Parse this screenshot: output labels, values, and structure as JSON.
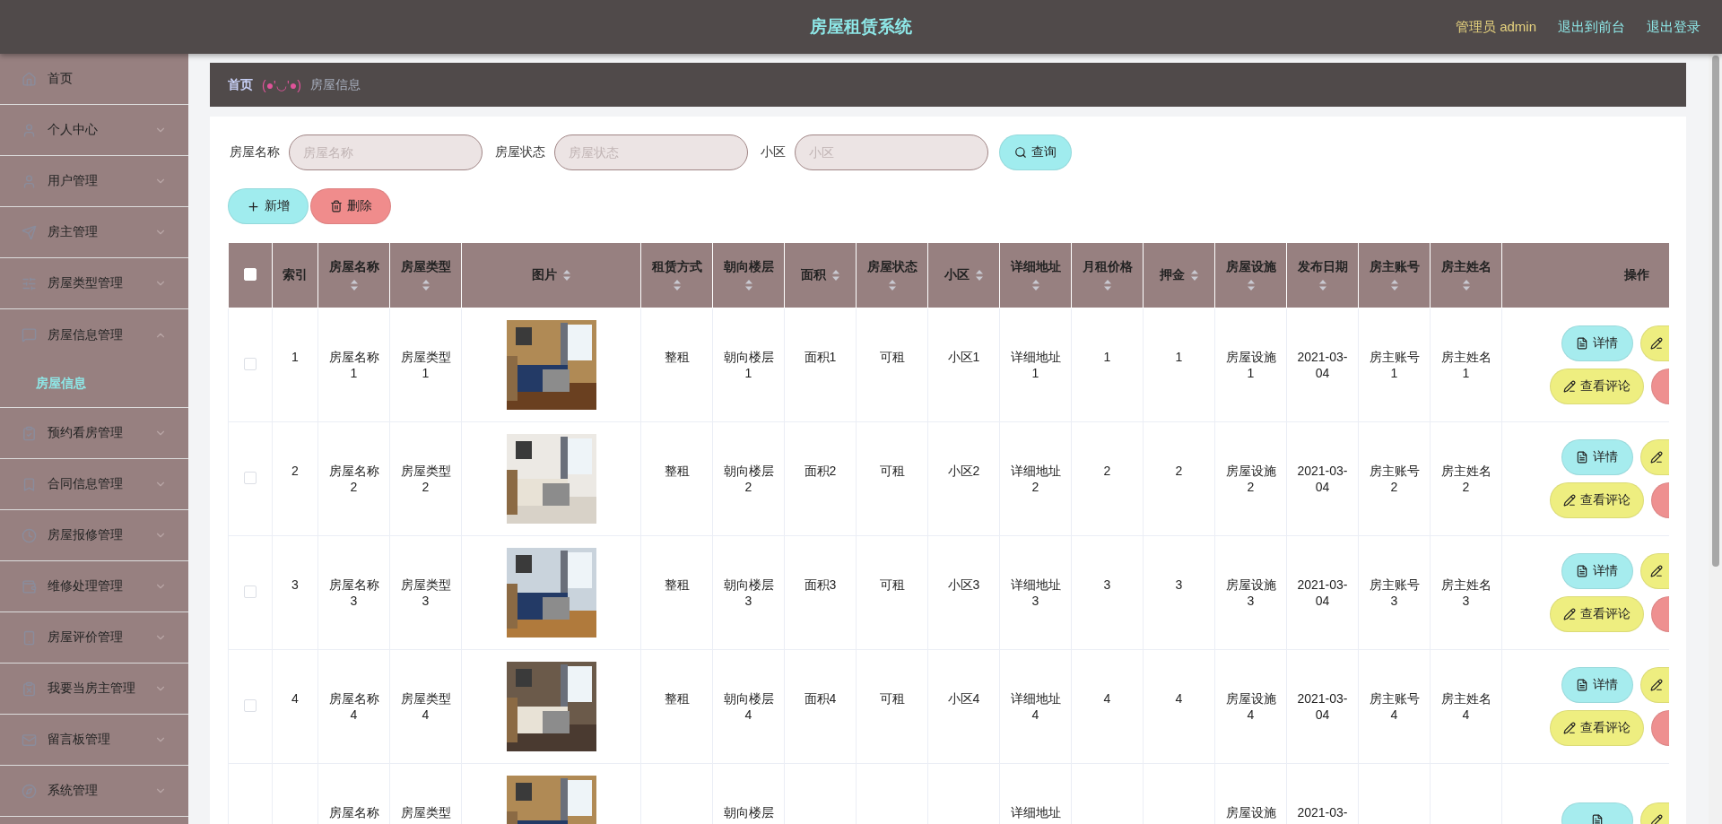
{
  "header": {
    "title": "房屋租赁系统",
    "user": "管理员 admin",
    "links": [
      "退出到前台",
      "退出登录"
    ]
  },
  "sidebar": {
    "items": [
      {
        "label": "首页",
        "kind": "link",
        "expanded": false
      },
      {
        "label": "个人中心",
        "kind": "menu",
        "expanded": false
      },
      {
        "label": "用户管理",
        "kind": "menu",
        "expanded": false
      },
      {
        "label": "房主管理",
        "kind": "menu",
        "expanded": false
      },
      {
        "label": "房屋类型管理",
        "kind": "menu",
        "expanded": false
      },
      {
        "label": "房屋信息管理",
        "kind": "menu",
        "expanded": true,
        "children": [
          {
            "label": "房屋信息",
            "selected": true
          }
        ]
      },
      {
        "label": "预约看房管理",
        "kind": "menu",
        "expanded": false
      },
      {
        "label": "合同信息管理",
        "kind": "menu",
        "expanded": false
      },
      {
        "label": "房屋报修管理",
        "kind": "menu",
        "expanded": false
      },
      {
        "label": "维修处理管理",
        "kind": "menu",
        "expanded": false
      },
      {
        "label": "房屋评价管理",
        "kind": "menu",
        "expanded": false
      },
      {
        "label": "我要当房主管理",
        "kind": "menu",
        "expanded": false
      },
      {
        "label": "留言板管理",
        "kind": "menu",
        "expanded": false
      },
      {
        "label": "系统管理",
        "kind": "menu",
        "expanded": false
      }
    ]
  },
  "breadcrumb": {
    "home": "首页",
    "separator": "(●'◡'●)",
    "current": "房屋信息"
  },
  "search": {
    "fields": [
      {
        "label": "房屋名称",
        "placeholder": "房屋名称"
      },
      {
        "label": "房屋状态",
        "placeholder": "房屋状态"
      },
      {
        "label": "小区",
        "placeholder": "小区"
      }
    ],
    "button": "查询"
  },
  "actions": [
    {
      "kind": "add",
      "label": "新增"
    },
    {
      "kind": "delete",
      "label": "删除"
    }
  ],
  "table": {
    "all_checked": false,
    "columns": [
      {
        "label": "索引",
        "sortable": false
      },
      {
        "label": "房屋名称",
        "sortable": true
      },
      {
        "label": "房屋类型",
        "sortable": true
      },
      {
        "label": "图片",
        "sortable": true
      },
      {
        "label": "租赁方式",
        "sortable": true
      },
      {
        "label": "朝向楼层",
        "sortable": true
      },
      {
        "label": "面积",
        "sortable": true
      },
      {
        "label": "房屋状态",
        "sortable": true
      },
      {
        "label": "小区",
        "sortable": true
      },
      {
        "label": "详细地址",
        "sortable": true
      },
      {
        "label": "月租价格",
        "sortable": true
      },
      {
        "label": "押金",
        "sortable": true
      },
      {
        "label": "房屋设施",
        "sortable": true
      },
      {
        "label": "发布日期",
        "sortable": true
      },
      {
        "label": "房主账号",
        "sortable": true
      },
      {
        "label": "房主姓名",
        "sortable": true
      },
      {
        "label": "操作",
        "sortable": false
      }
    ],
    "rows": [
      {
        "checked": false,
        "cells": [
          "1",
          "房屋名称 1",
          "房屋类型 1",
          {
            "kind": "picture"
          },
          "整租",
          "朝向楼层 1",
          "面积1",
          "可租",
          "小区1",
          "详细地址 1",
          "1",
          "1",
          "房屋设施 1",
          "2021-03-04",
          "房主账号 1",
          "房主姓名 1"
        ],
        "buttons": [
          {
            "kind": "detail",
            "label": "详情"
          },
          {
            "kind": "edit"
          },
          {
            "kind": "comments",
            "label": "查看评论"
          },
          {
            "kind": "delete"
          }
        ]
      },
      {
        "checked": false,
        "cells": [
          "2",
          "房屋名称 2",
          "房屋类型 2",
          {
            "kind": "picture"
          },
          "整租",
          "朝向楼层 2",
          "面积2",
          "可租",
          "小区2",
          "详细地址 2",
          "2",
          "2",
          "房屋设施 2",
          "2021-03-04",
          "房主账号 2",
          "房主姓名 2"
        ],
        "buttons": [
          {
            "kind": "detail",
            "label": "详情"
          },
          {
            "kind": "edit"
          },
          {
            "kind": "comments",
            "label": "查看评论"
          },
          {
            "kind": "delete"
          }
        ]
      },
      {
        "checked": false,
        "cells": [
          "3",
          "房屋名称 3",
          "房屋类型 3",
          {
            "kind": "picture"
          },
          "整租",
          "朝向楼层 3",
          "面积3",
          "可租",
          "小区3",
          "详细地址 3",
          "3",
          "3",
          "房屋设施 3",
          "2021-03-04",
          "房主账号 3",
          "房主姓名 3"
        ],
        "buttons": [
          {
            "kind": "detail",
            "label": "详情"
          },
          {
            "kind": "edit"
          },
          {
            "kind": "comments",
            "label": "查看评论"
          },
          {
            "kind": "delete"
          }
        ]
      },
      {
        "checked": false,
        "cells": [
          "4",
          "房屋名称 4",
          "房屋类型 4",
          {
            "kind": "picture"
          },
          "整租",
          "朝向楼层 4",
          "面积4",
          "可租",
          "小区4",
          "详细地址 4",
          "4",
          "4",
          "房屋设施 4",
          "2021-03-04",
          "房主账号 4",
          "房主姓名 4"
        ],
        "buttons": [
          {
            "kind": "detail",
            "label": "详情"
          },
          {
            "kind": "edit"
          },
          {
            "kind": "comments",
            "label": "查看评论"
          },
          {
            "kind": "delete"
          }
        ]
      }
    ],
    "partial_row": {
      "cells": [
        {
          "kind": "hidden"
        },
        "房屋名称",
        "房屋类型",
        {
          "kind": "picture"
        },
        {
          "kind": "hidden"
        },
        "朝向楼层",
        {
          "kind": "hidden"
        },
        {
          "kind": "hidden"
        },
        {
          "kind": "hidden"
        },
        "详细地址",
        {
          "kind": "hidden"
        },
        {
          "kind": "hidden"
        },
        "房屋设施",
        "2021-03-",
        {
          "kind": "hidden"
        },
        {
          "kind": "hidden"
        }
      ],
      "buttons": [
        {
          "kind": "detail"
        },
        {
          "kind": "edit"
        }
      ]
    }
  }
}
